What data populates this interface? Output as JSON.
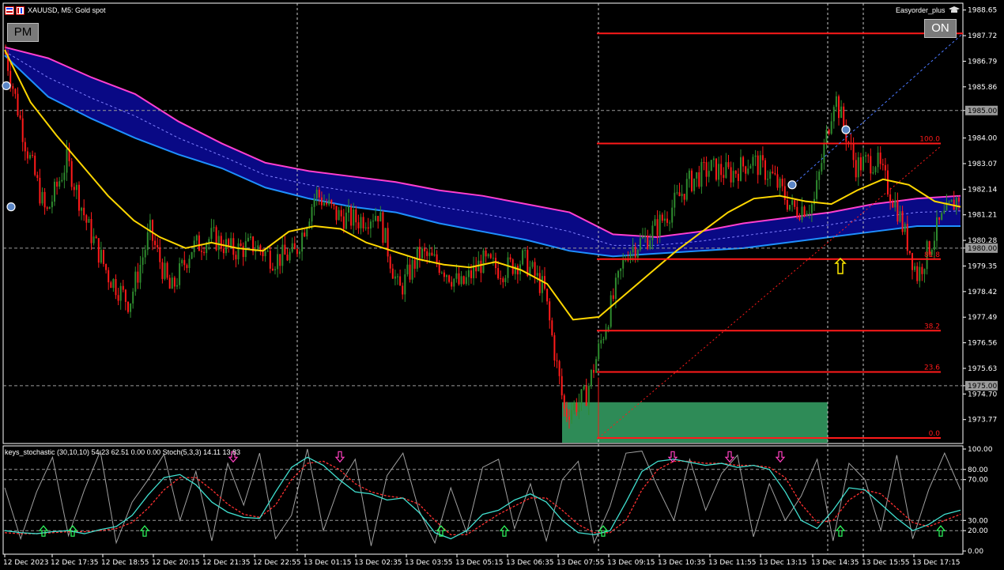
{
  "header": {
    "symbol_title": "XAUUSD, M5:  Gold spot",
    "ea_name": "Easyorder_plus",
    "pm_button": "PM",
    "on_button": "ON"
  },
  "subwindow": {
    "title": "keys_stochastic (30,10,10) 54.23 62.51 0.00 0.00 Stoch(5,3,3) 14.11 13.83"
  },
  "colors": {
    "background": "#000000",
    "bull_candle": "#2e8b2e",
    "bear_candle": "#ff1a1a",
    "ma_yellow": "#ffd700",
    "band_fill": "#0a0a8c",
    "band_upper": "#ff3fd0",
    "band_lower": "#1e90ff",
    "fib_lines": "#ff1a1a",
    "demand_zone": "#2e8b57",
    "stoch_main": "#40e0d0",
    "stoch_signal": "#ff3030",
    "stoch_fast": "#a0a0a0"
  },
  "chart_data": [
    {
      "type": "candlestick",
      "symbol": "XAUUSD",
      "timeframe": "M5",
      "description": "Gold spot",
      "x_ticks": [
        "12 Dec 2023",
        "12 Dec 17:35",
        "12 Dec 18:55",
        "12 Dec 20:15",
        "12 Dec 21:35",
        "12 Dec 22:55",
        "13 Dec 01:15",
        "13 Dec 02:35",
        "13 Dec 03:55",
        "13 Dec 05:15",
        "13 Dec 06:35",
        "13 Dec 07:55",
        "13 Dec 09:15",
        "13 Dec 10:35",
        "13 Dec 11:55",
        "13 Dec 13:15",
        "13 Dec 14:35",
        "13 Dec 15:55",
        "13 Dec 17:15"
      ],
      "y_ticks": [
        "1988.65",
        "1987.72",
        "1986.79",
        "1985.86",
        "1985.00",
        "1984.00",
        "1983.07",
        "1982.14",
        "1981.21",
        "1980.28",
        "1980.00",
        "1979.35",
        "1978.42",
        "1977.49",
        "1976.56",
        "1975.63",
        "1975.00",
        "1974.70",
        "1973.77"
      ],
      "ylim": [
        1972.9,
        1988.9
      ],
      "price_path": [
        1987.2,
        1983.8,
        1981.2,
        1983.2,
        1980.8,
        1979.0,
        1978.0,
        1980.6,
        1978.4,
        1980.0,
        1980.4,
        1979.9,
        1980.1,
        1979.6,
        1979.8,
        1982.0,
        1981.2,
        1981.0,
        1981.3,
        1978.4,
        1979.8,
        1979.4,
        1978.6,
        1979.5,
        1979.2,
        1979.6,
        1978.5,
        1974.0,
        1974.6,
        1977.3,
        1979.9,
        1980.4,
        1981.3,
        1982.4,
        1982.9,
        1982.7,
        1983.2,
        1982.6,
        1981.4,
        1981.6,
        1985.6,
        1983.0,
        1983.2,
        1981.5,
        1979.0,
        1980.8,
        1981.9
      ],
      "series": [
        {
          "kind": "ma_yellow",
          "values": [
            1987.2,
            1985.3,
            1984.1,
            1983.0,
            1981.9,
            1981.0,
            1980.4,
            1980.0,
            1980.2,
            1980.0,
            1979.9,
            1980.6,
            1980.8,
            1980.7,
            1980.2,
            1979.9,
            1979.6,
            1979.4,
            1979.3,
            1979.5,
            1979.2,
            1978.7,
            1977.4,
            1977.5,
            1978.3,
            1979.1,
            1979.9,
            1980.6,
            1981.3,
            1981.8,
            1981.9,
            1981.7,
            1981.6,
            1982.1,
            1982.5,
            1982.3,
            1981.7,
            1981.5
          ]
        },
        {
          "kind": "band_upper",
          "values": [
            1987.3,
            1986.9,
            1986.2,
            1985.6,
            1984.6,
            1983.8,
            1983.1,
            1982.8,
            1982.6,
            1982.4,
            1982.1,
            1981.9,
            1981.6,
            1981.3,
            1980.5,
            1980.4,
            1980.6,
            1980.9,
            1981.1,
            1981.3,
            1981.6,
            1981.8,
            1981.9
          ]
        },
        {
          "kind": "band_lower",
          "values": [
            1987.0,
            1985.5,
            1984.7,
            1984.0,
            1983.4,
            1982.9,
            1982.2,
            1981.8,
            1981.5,
            1981.3,
            1980.9,
            1980.6,
            1980.3,
            1979.9,
            1979.7,
            1979.8,
            1979.9,
            1980.0,
            1980.2,
            1980.4,
            1980.6,
            1980.8,
            1980.8
          ]
        }
      ],
      "fibonacci": {
        "levels": [
          "100.0",
          "81.8",
          "38.2",
          "23.6",
          "0.0"
        ],
        "prices": [
          1983.8,
          1979.6,
          1977.0,
          1975.5,
          1973.1
        ],
        "top_line": 1987.8
      },
      "horizontal_lines": [
        1985.0,
        1980.0,
        1975.0
      ],
      "vertical_lines": [
        "12 Dec 23:05",
        "13 Dec 07:55",
        "13 Dec 14:35",
        "13 Dec 15:55"
      ]
    },
    {
      "type": "line",
      "name": "keys_stochastic (30,10,10)",
      "ylim": [
        0,
        100
      ],
      "y_ticks": [
        "100.00",
        "80.00",
        "70.00",
        "30.00",
        "20.00",
        "0.00"
      ],
      "levels": [
        80,
        70,
        30,
        20
      ],
      "series": [
        {
          "name": "main",
          "values": [
            20,
            18,
            17,
            19,
            20,
            17,
            21,
            24,
            35,
            55,
            72,
            75,
            65,
            48,
            38,
            33,
            32,
            58,
            82,
            92,
            84,
            70,
            58,
            56,
            50,
            52,
            38,
            18,
            12,
            20,
            36,
            40,
            50,
            56,
            48,
            30,
            18,
            16,
            20,
            48,
            78,
            88,
            90,
            87,
            84,
            86,
            82,
            84,
            80,
            58,
            30,
            22,
            40,
            62,
            60,
            46,
            32,
            20,
            26,
            36,
            40
          ]
        },
        {
          "name": "signal",
          "values": [
            18,
            17,
            17,
            18,
            19,
            19,
            20,
            22,
            28,
            42,
            60,
            72,
            72,
            60,
            46,
            36,
            33,
            45,
            70,
            86,
            88,
            80,
            66,
            58,
            54,
            52,
            46,
            30,
            16,
            16,
            26,
            36,
            44,
            52,
            52,
            40,
            26,
            18,
            18,
            30,
            60,
            80,
            88,
            88,
            86,
            86,
            84,
            84,
            82,
            72,
            46,
            28,
            30,
            50,
            60,
            56,
            42,
            28,
            24,
            30,
            36
          ]
        },
        {
          "name": "fast",
          "values": [
            62,
            12,
            58,
            92,
            15,
            60,
            98,
            8,
            48,
            70,
            95,
            30,
            78,
            10,
            86,
            45,
            96,
            12,
            35,
            100,
            20,
            64,
            90,
            5,
            74,
            96,
            40,
            8,
            62,
            18,
            82,
            90,
            22,
            66,
            10,
            70,
            88,
            8,
            44,
            96,
            98,
            62,
            30,
            90,
            40,
            76,
            94,
            14,
            66,
            30,
            54,
            90,
            10,
            86,
            70,
            20,
            94,
            12,
            60,
            96,
            60
          ]
        }
      ]
    }
  ]
}
